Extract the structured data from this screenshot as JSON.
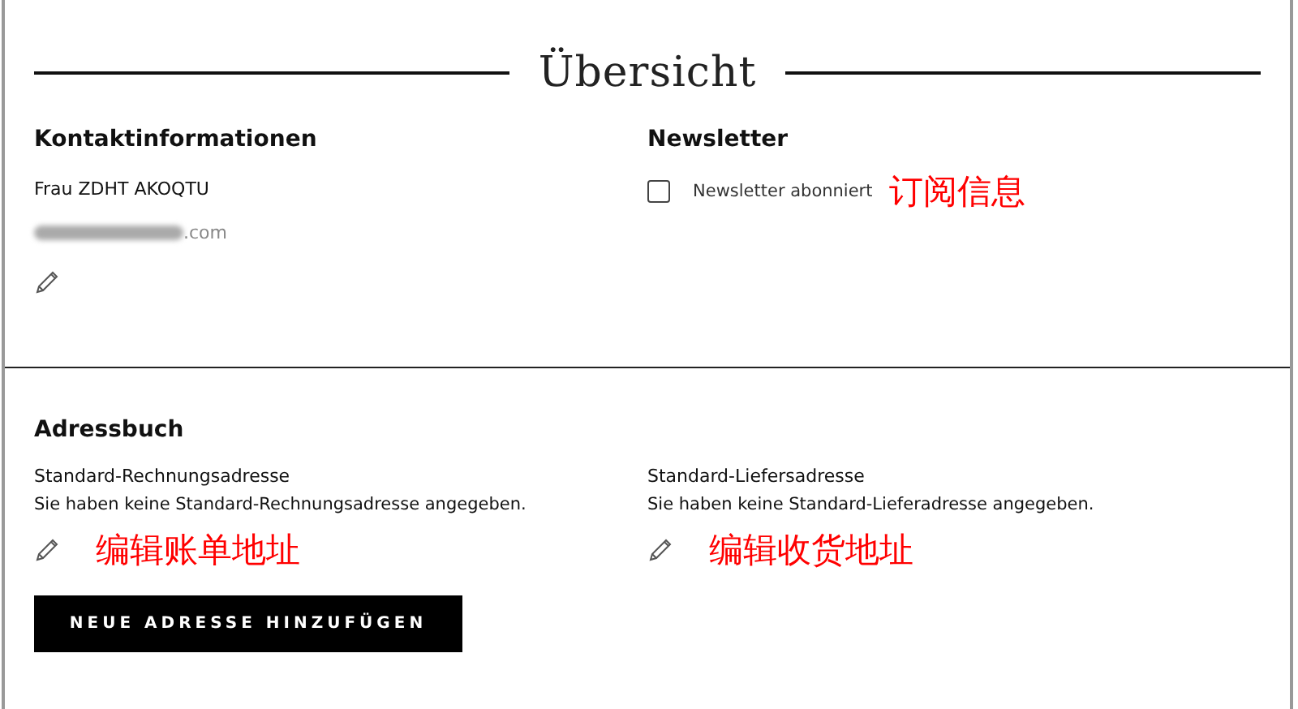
{
  "title": "Übersicht",
  "contact": {
    "heading": "Kontaktinformationen",
    "name": "Frau ZDHT AKOQTU",
    "email_visible": ".com"
  },
  "newsletter": {
    "heading": "Newsletter",
    "checkbox": {
      "label": "Newsletter abonniert",
      "checked": false
    },
    "annotation": "订阅信息"
  },
  "address_book": {
    "heading": "Adressbuch",
    "columns": [
      {
        "title": "Standard-Rechnungsadresse",
        "text": "Sie haben keine Standard-Rechnungsadresse angegeben.",
        "annotation": "编辑账单地址"
      },
      {
        "title": "Standard-Liefersadresse",
        "text": "Sie haben keine Standard-Lieferadresse angegeben.",
        "annotation": "编辑收货地址"
      }
    ],
    "button": "NEUE ADRESSE HINZUFÜGEN"
  }
}
